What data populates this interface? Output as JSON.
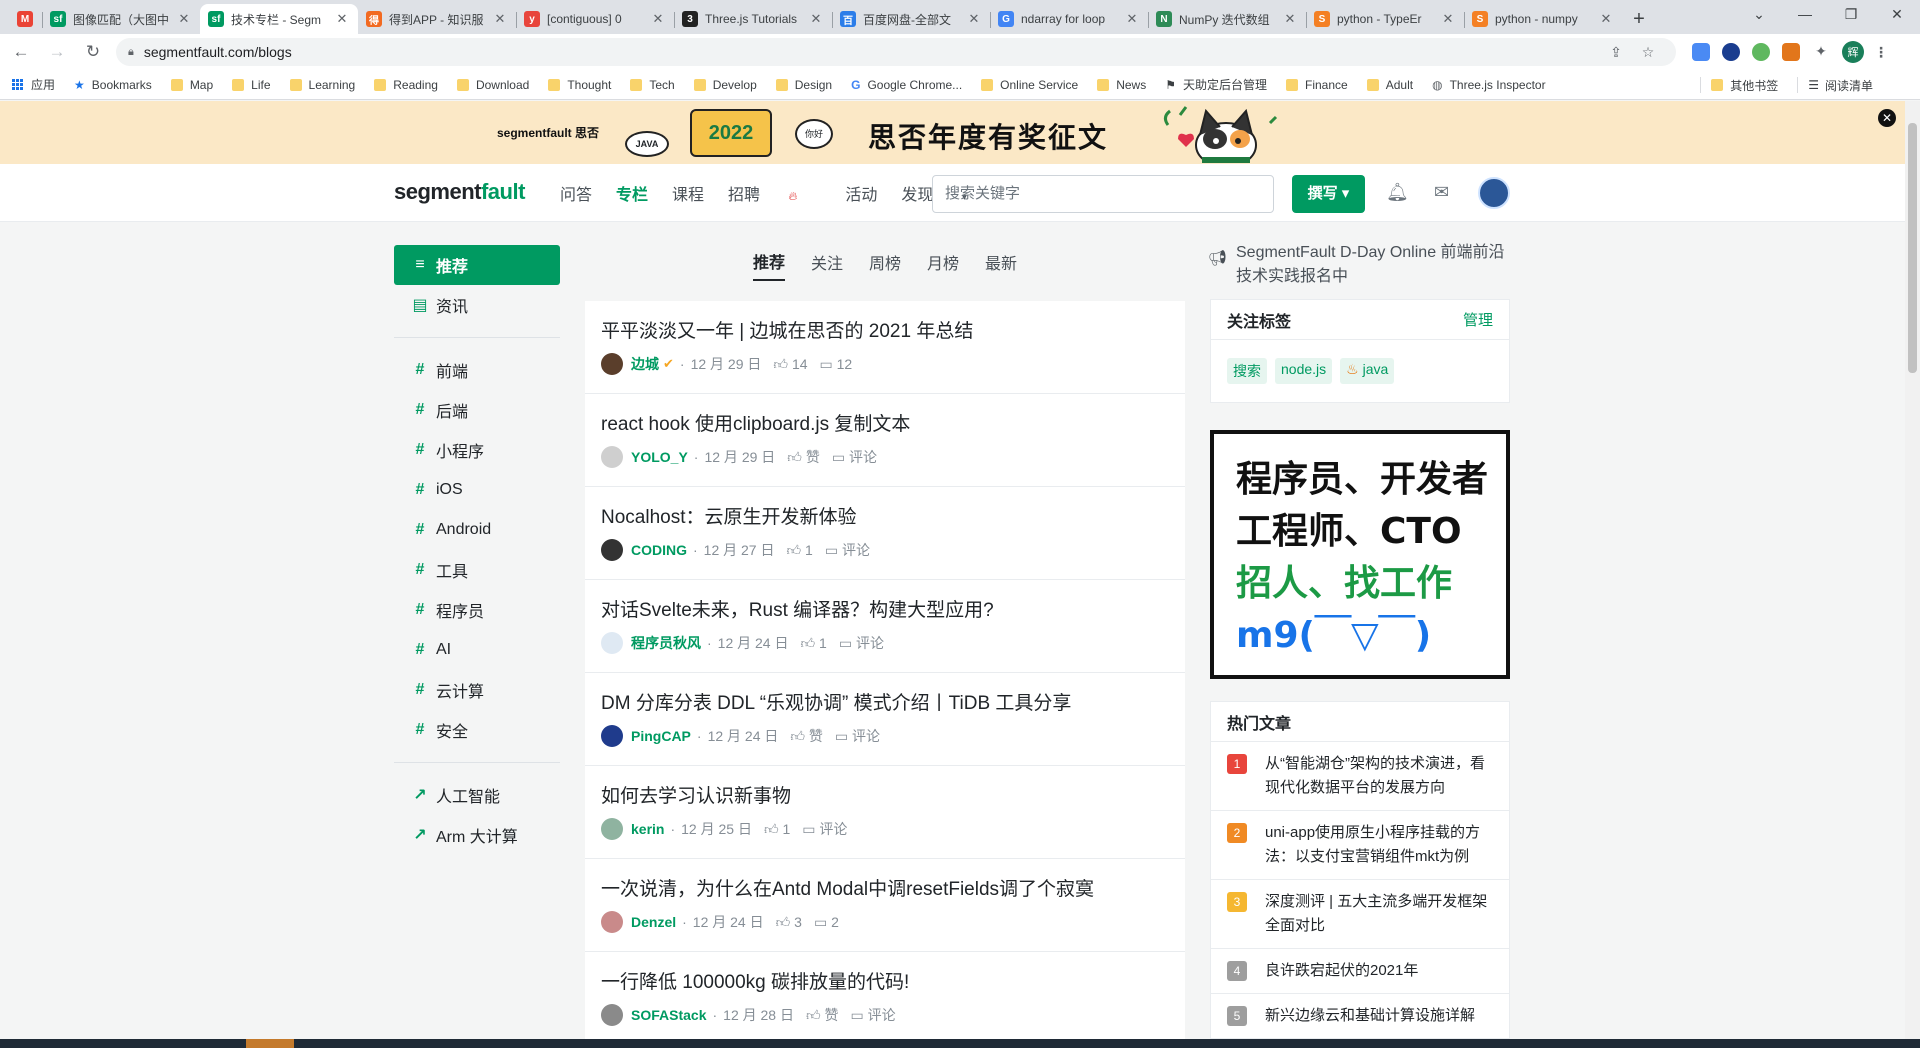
{
  "browser": {
    "tabs": [
      {
        "title": "",
        "color": "#ea4335",
        "glyph": "M",
        "small": true
      },
      {
        "title": "图像匹配（大图中",
        "color": "#009a61",
        "glyph": "sf"
      },
      {
        "title": "技术专栏 - Segm",
        "color": "#009a61",
        "glyph": "sf",
        "active": true
      },
      {
        "title": "得到APP - 知识服",
        "color": "#f26a21",
        "glyph": "得"
      },
      {
        "title": "[contiguous] 0",
        "color": "#e8453c",
        "glyph": "y"
      },
      {
        "title": "Three.js Tutorials",
        "color": "#222222",
        "glyph": "3"
      },
      {
        "title": "百度网盘-全部文",
        "color": "#2b7de9",
        "glyph": "百"
      },
      {
        "title": "ndarray for loop",
        "color": "#4285f4",
        "glyph": "G"
      },
      {
        "title": "NumPy 迭代数组",
        "color": "#2e8b57",
        "glyph": "N"
      },
      {
        "title": "python - TypeEr",
        "color": "#f48024",
        "glyph": "S"
      },
      {
        "title": "python - numpy",
        "color": "#f48024",
        "glyph": "S"
      }
    ],
    "url": "segmentfault.com/blogs",
    "bookmarks": [
      "应用",
      "Bookmarks",
      "Map",
      "Life",
      "Learning",
      "Reading",
      "Download",
      "Thought",
      "Tech",
      "Develop",
      "Design",
      "Google Chrome...",
      "Online Service",
      "News",
      "天助定后台管理",
      "Finance",
      "Adult",
      "Three.js Inspector"
    ],
    "bookmarks_right": [
      "其他书签",
      "阅读清单"
    ]
  },
  "banner": {
    "brand": "segmentfault 思否",
    "java": "JAVA",
    "year": "2022",
    "bubble": "你好",
    "headline": "思否年度有奖征文",
    "close": "✕"
  },
  "header": {
    "logo_a": "segment",
    "logo_b": "fault",
    "nav": [
      "问答",
      "专栏",
      "课程",
      "招聘",
      "活动",
      "发现"
    ],
    "search_placeholder": "搜索关键字",
    "write": "撰写 ▾"
  },
  "leftnav": {
    "top": [
      {
        "label": "推荐",
        "icon": "≡"
      },
      {
        "label": "资讯",
        "icon": "▤"
      }
    ],
    "tags": [
      "前端",
      "后端",
      "小程序",
      "iOS",
      "Android",
      "工具",
      "程序员",
      "AI",
      "云计算",
      "安全"
    ],
    "links": [
      "人工智能",
      "Arm 大计算"
    ]
  },
  "feed_tabs": [
    "推荐",
    "关注",
    "周榜",
    "月榜",
    "最新"
  ],
  "posts": [
    {
      "title": "平平淡淡又一年 | 边城在思否的 2021 年总结",
      "author": "边城",
      "date": "12 月 29 日",
      "likes": "14",
      "comments": "12",
      "av": "#5a3e2b",
      "verified": true
    },
    {
      "title": "react hook 使用clipboard.js 复制文本",
      "author": "YOLO_Y",
      "date": "12 月 29 日",
      "likes": "赞",
      "comments": "评论",
      "av": "#cfcfcf"
    },
    {
      "title": "Nocalhost：云原生开发新体验",
      "author": "CODING",
      "date": "12 月 27 日",
      "likes": "1",
      "comments": "评论",
      "av": "#333333"
    },
    {
      "title": "对话Svelte未来，Rust 编译器？构建大型应用?",
      "author": "程序员秋风",
      "date": "12 月 24 日",
      "likes": "1",
      "comments": "评论",
      "av": "#dfe9f3"
    },
    {
      "title": "DM 分库分表 DDL “乐观协调” 模式介绍丨TiDB 工具分享",
      "author": "PingCAP",
      "date": "12 月 24 日",
      "likes": "赞",
      "comments": "评论",
      "av": "#1f3b8c"
    },
    {
      "title": "如何去学习认识新事物",
      "author": "kerin",
      "date": "12 月 25 日",
      "likes": "1",
      "comments": "评论",
      "av": "#8fb3a0"
    },
    {
      "title": "一次说清，为什么在Antd Modal中调resetFields调了个寂寞",
      "author": "Denzel",
      "date": "12 月 24 日",
      "likes": "3",
      "comments": "2",
      "av": "#c98a8a"
    },
    {
      "title": "一行降低 100000kg 碳排放量的代码!",
      "author": "SOFAStack",
      "date": "12 月 28 日",
      "likes": "赞",
      "comments": "评论",
      "av": "#8a8a8a"
    }
  ],
  "right": {
    "promo": "SegmentFault D-Day Online 前端前沿技术实践报名中",
    "follow_title": "关注标签",
    "manage": "管理",
    "tags": [
      "搜索",
      "node.js",
      "java"
    ],
    "ad": [
      "程序员、开发者",
      "工程师、CTO",
      "招人、找工作",
      "m9(￣▽￣)"
    ],
    "hot_title": "热门文章",
    "hot": [
      {
        "n": "1",
        "color": "#e8453c",
        "title": "从“智能湖仓”架构的技术演进，看现代化数据平台的发展方向"
      },
      {
        "n": "2",
        "color": "#f08a24",
        "title": "uni-app使用原生小程序挂载的方法：以支付宝营销组件mkt为例"
      },
      {
        "n": "3",
        "color": "#f5b731",
        "title": "深度测评 | 五大主流多端开发框架全面对比"
      },
      {
        "n": "4",
        "color": "#9e9e9e",
        "title": "良许跌宕起伏的2021年"
      },
      {
        "n": "5",
        "color": "#9e9e9e",
        "title": "新兴边缘云和基础计算设施详解"
      }
    ]
  }
}
